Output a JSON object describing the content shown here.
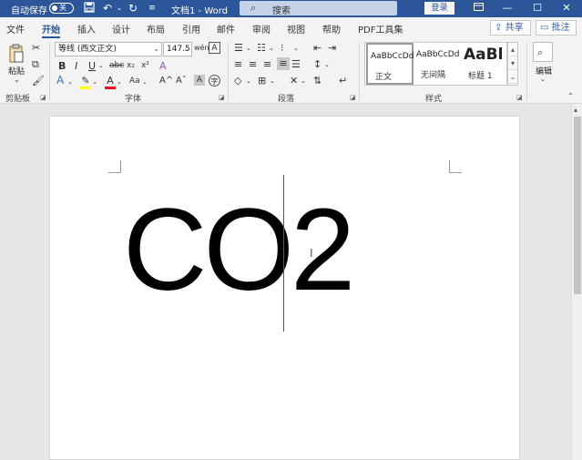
{
  "titlebar": {
    "autosave_label": "自动保存",
    "autosave_state": "关",
    "doc_title": "文档1 - Word",
    "search_placeholder": "搜索",
    "login_label": "登录",
    "bg_color": "#2b579a"
  },
  "tabs": [
    {
      "label": "文件"
    },
    {
      "label": "开始",
      "active": true
    },
    {
      "label": "插入"
    },
    {
      "label": "设计"
    },
    {
      "label": "布局"
    },
    {
      "label": "引用"
    },
    {
      "label": "邮件"
    },
    {
      "label": "审阅"
    },
    {
      "label": "视图"
    },
    {
      "label": "帮助"
    },
    {
      "label": "PDF工具集"
    }
  ],
  "share_label": "共享",
  "comment_label": "批注",
  "clipboard": {
    "paste_label": "粘贴",
    "group_label": "剪贴板"
  },
  "font": {
    "font_name": "等线 (西文正文)",
    "font_size": "147.5",
    "group_label": "字体",
    "bold": "B",
    "italic": "I",
    "underline": "U",
    "strike": "abc",
    "subscript": "x₂",
    "superscript": "x²",
    "change_case": "Aa",
    "grow": "A^",
    "shrink": "Aˇ"
  },
  "paragraph": {
    "group_label": "段落"
  },
  "styles": {
    "group_label": "样式",
    "items": [
      {
        "preview": "AaBbCcDd",
        "name": "正文"
      },
      {
        "preview": "AaBbCcDd",
        "name": "无间隔"
      },
      {
        "preview": "AaBl",
        "name": "标题 1"
      }
    ]
  },
  "editing": {
    "label": "编辑"
  },
  "document": {
    "text": "CO2"
  }
}
